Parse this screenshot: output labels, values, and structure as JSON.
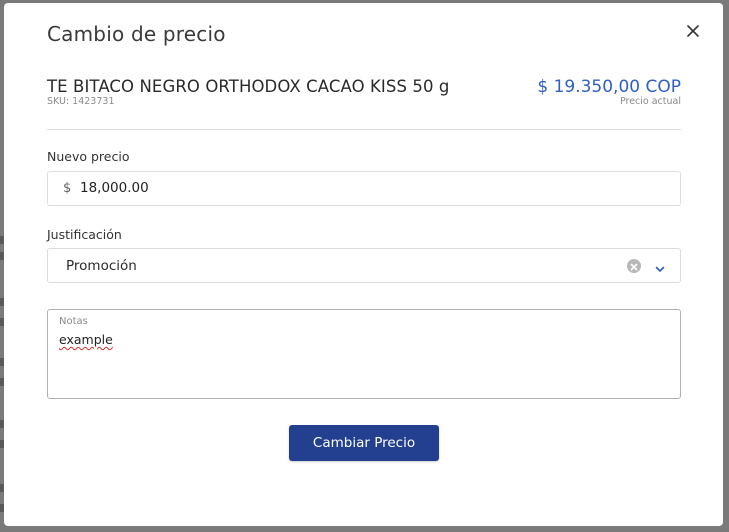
{
  "modal": {
    "title": "Cambio de precio",
    "close_icon": "close-icon"
  },
  "product": {
    "name": "TE BITACO NEGRO ORTHODOX CACAO KISS 50 g",
    "sku": "SKU: 1423731",
    "current_price": "$ 19.350,00 COP",
    "current_price_caption": "Precio actual"
  },
  "form": {
    "new_price": {
      "label": "Nuevo precio",
      "currency_symbol": "$",
      "value": "18,000.00"
    },
    "justification": {
      "label": "Justificación",
      "selected": "Promoción",
      "clear_icon": "clear-circle-icon",
      "dropdown_icon": "chevron-down-icon"
    },
    "notes": {
      "label": "Notas",
      "value": "example"
    },
    "submit_label": "Cambiar Precio"
  },
  "colors": {
    "accent_price": "#2f5ec4",
    "primary_button": "#233f8f",
    "overlay": "#7a7a7a"
  }
}
